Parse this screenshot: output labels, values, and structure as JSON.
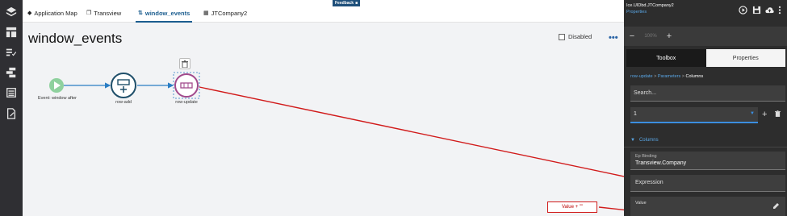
{
  "tabs": [
    {
      "label": "Application Map",
      "icon": "layers-icon"
    },
    {
      "label": "Transview",
      "icon": "copy-icon"
    },
    {
      "label": "window_events",
      "icon": "flow-icon",
      "active": true
    },
    {
      "label": "JTCompany2",
      "icon": "table-icon"
    }
  ],
  "feedback_label": "Feedback",
  "canvas": {
    "title": "window_events",
    "disabled_label": "Disabled",
    "more_label": "•••",
    "nodes": [
      {
        "label": "Event: window after"
      },
      {
        "label": "row-add"
      },
      {
        "label": "row-update"
      }
    ],
    "annotation": "Value + \"\""
  },
  "panel": {
    "title": "Ice.UIDbd.JTCompany2",
    "subtitle": "Properties",
    "zoom": {
      "minus": "−",
      "value": "100%",
      "plus": "+"
    },
    "tabs": {
      "toolbox": "Toolbox",
      "properties": "Properties"
    },
    "breadcrumb": {
      "part1": "row-update",
      "part2": "Parameters",
      "current": "Columns",
      "sep": ">"
    },
    "search_placeholder": "Search...",
    "select_value": "1",
    "add_label": "+",
    "columns_section": "Columns",
    "ep_binding_label": "Ep Binding",
    "ep_binding_value": "Transview.Company",
    "expression_label": "Expression",
    "value_label": "Value"
  },
  "colors": {
    "rail": "#2f2f33",
    "canvas": "#f2f3f5",
    "panel": "#2d2d2d",
    "accent": "#1b5d8f",
    "start_node": "#8fd19e",
    "arrow": "#d11a1a"
  }
}
